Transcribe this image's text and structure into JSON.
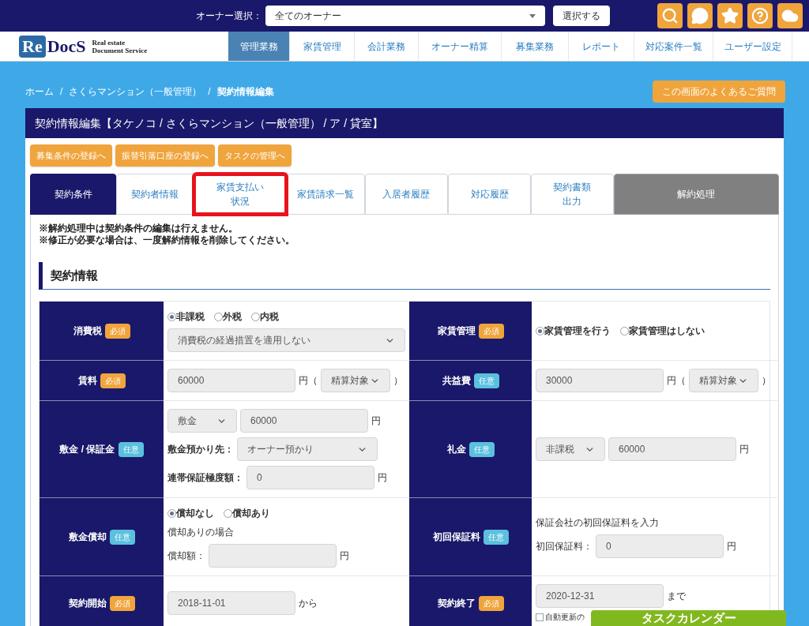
{
  "topbar": {
    "owner_label": "オーナー選択：",
    "owner_select": "全てのオーナー",
    "select_button": "選択する",
    "icons": [
      {
        "kind": "search"
      },
      {
        "kind": "chat"
      },
      {
        "kind": "star"
      },
      {
        "kind": "help"
      },
      {
        "kind": "cloud"
      }
    ]
  },
  "nav": {
    "logo": {
      "mark": "Re",
      "name": "DocS",
      "tagline_1": "Real estate",
      "tagline_2": "Document Service"
    },
    "items": [
      {
        "label": "管理業務",
        "selected": true
      },
      {
        "label": "家賃管理",
        "selected": false
      },
      {
        "label": "会計業務",
        "selected": false
      },
      {
        "label": "オーナー精算",
        "selected": false
      },
      {
        "label": "募集業務",
        "selected": false
      },
      {
        "label": "レポート",
        "selected": false
      },
      {
        "label": "対応案件一覧",
        "selected": false
      },
      {
        "label": "ユーザー設定",
        "selected": false
      }
    ]
  },
  "breadcrumb": [
    {
      "label": "ホーム"
    },
    {
      "separator": "/",
      "label": "さくらマンション（一般管理）"
    },
    {
      "separator": "/",
      "label": "契約情報編集"
    }
  ],
  "faq_button": "この画面のよくあるご質問",
  "panel": {
    "title": "契約情報編集【タケノコ / さくらマンション（一般管理） / ア / 貸室】",
    "actions": [
      "募集条件の登録へ",
      "振替引落口座の登録へ",
      "タスクの管理へ"
    ],
    "tabs": [
      {
        "label": "契約条件",
        "selected": true,
        "kind": "tab",
        "highlighted": false
      },
      {
        "label": "契約者情報",
        "selected": false,
        "kind": "tab",
        "highlighted": false
      },
      {
        "lines": [
          "家賃支払い",
          "状況"
        ],
        "selected": false,
        "kind": "tab",
        "highlighted": true
      },
      {
        "label": "家賃請求一覧",
        "selected": false,
        "kind": "tab",
        "highlighted": false
      },
      {
        "label": "入居者履歴",
        "selected": false,
        "kind": "tab",
        "highlighted": false
      },
      {
        "label": "対応履歴",
        "selected": false,
        "kind": "tab",
        "highlighted": false
      },
      {
        "lines": [
          "契約書類",
          "出力"
        ],
        "selected": false,
        "kind": "tab",
        "highlighted": false
      },
      {
        "label": "解約処理",
        "selected": false,
        "kind": "action",
        "highlighted": false
      }
    ],
    "notes": [
      "※解約処理中は契約条件の編集は行えません。",
      "※修正が必要な場合は、一度解約情報を削除してください。"
    ],
    "section_title": "契約情報",
    "rows": [
      [
        {
          "label": "消費税",
          "badge": {
            "text": "必須",
            "kind": "required"
          },
          "lines": [
            [
              {
                "kind": "radio",
                "label": "非課税",
                "selected": true
              },
              {
                "kind": "radio",
                "label": "外税",
                "selected": false
              },
              {
                "kind": "radio",
                "label": "内税",
                "selected": false
              }
            ],
            [
              {
                "kind": "select_full",
                "value": "消費税の経過措置を適用しない"
              }
            ]
          ]
        },
        {
          "label": "家賃管理",
          "badge": {
            "text": "必須",
            "kind": "required"
          },
          "lines": [
            [
              {
                "kind": "radio",
                "label": "家賃管理を行う",
                "selected": true
              },
              {
                "kind": "radio",
                "label": "家賃管理はしない",
                "selected": false
              }
            ]
          ]
        }
      ],
      [
        {
          "label": "賃料",
          "badge": {
            "text": "必須",
            "kind": "required"
          },
          "lines": [
            [
              {
                "kind": "input",
                "value": "60000"
              },
              {
                "kind": "text",
                "text": "円（"
              },
              {
                "kind": "select",
                "value": "精算対象"
              },
              {
                "kind": "text",
                "text": "）"
              }
            ]
          ]
        },
        {
          "label": "共益費",
          "badge": {
            "text": "任意",
            "kind": "optional"
          },
          "lines": [
            [
              {
                "kind": "input",
                "value": "30000"
              },
              {
                "kind": "text",
                "text": "円（"
              },
              {
                "kind": "select",
                "value": "精算対象"
              },
              {
                "kind": "text",
                "text": "）"
              }
            ]
          ]
        }
      ],
      [
        {
          "label": "敷金 / 保証金",
          "badge": {
            "text": "任意",
            "kind": "optional"
          },
          "lines": [
            [
              {
                "kind": "select",
                "value": "敷金"
              },
              {
                "kind": "input",
                "value": "60000"
              },
              {
                "kind": "text",
                "text": "円"
              }
            ],
            [
              {
                "kind": "label",
                "text": "敷金預かり先："
              },
              {
                "kind": "select_wide",
                "value": "オーナー預かり"
              }
            ],
            [
              {
                "kind": "label",
                "text": "連帯保証極度額："
              },
              {
                "kind": "input",
                "value": "0"
              },
              {
                "kind": "text",
                "text": "円"
              }
            ]
          ]
        },
        {
          "label": "礼金",
          "badge": {
            "text": "任意",
            "kind": "optional"
          },
          "lines": [
            [
              {
                "kind": "select",
                "value": "非課税"
              },
              {
                "kind": "input",
                "value": "60000"
              },
              {
                "kind": "text",
                "text": "円"
              }
            ]
          ]
        }
      ],
      [
        {
          "label": "敷金償却",
          "badge": {
            "text": "任意",
            "kind": "optional"
          },
          "lines": [
            [
              {
                "kind": "radio",
                "label": "償却なし",
                "selected": true
              },
              {
                "kind": "radio",
                "label": "償却あり",
                "selected": false
              }
            ],
            [
              {
                "kind": "text",
                "text": "償却ありの場合"
              }
            ],
            [
              {
                "kind": "text",
                "text": "償却額："
              },
              {
                "kind": "input"
              },
              {
                "kind": "text",
                "text": "円"
              }
            ]
          ]
        },
        {
          "label": "初回保証料",
          "badge": {
            "text": "任意",
            "kind": "optional"
          },
          "lines": [
            [
              {
                "kind": "text",
                "text": "保証会社の初回保証料を入力"
              }
            ],
            [
              {
                "kind": "text",
                "text": "初回保証料："
              },
              {
                "kind": "input",
                "value": "0"
              },
              {
                "kind": "text",
                "text": "円"
              }
            ]
          ]
        }
      ],
      [
        {
          "label": "契約開始",
          "badge": {
            "text": "必須",
            "kind": "required"
          },
          "lines": [
            [
              {
                "kind": "input",
                "value": "2018-11-01"
              },
              {
                "kind": "text",
                "text": "から"
              }
            ]
          ]
        },
        {
          "label": "契約終了",
          "badge": {
            "text": "必須",
            "kind": "required"
          },
          "lines": [
            [
              {
                "kind": "input",
                "value": "2020-12-31"
              },
              {
                "kind": "text",
                "text": "まで"
              }
            ],
            [
              {
                "kind": "checkbox",
                "label": "自動更新の",
                "checked": false
              }
            ]
          ]
        }
      ]
    ]
  },
  "task_calendar": "タスクカレンダー"
}
